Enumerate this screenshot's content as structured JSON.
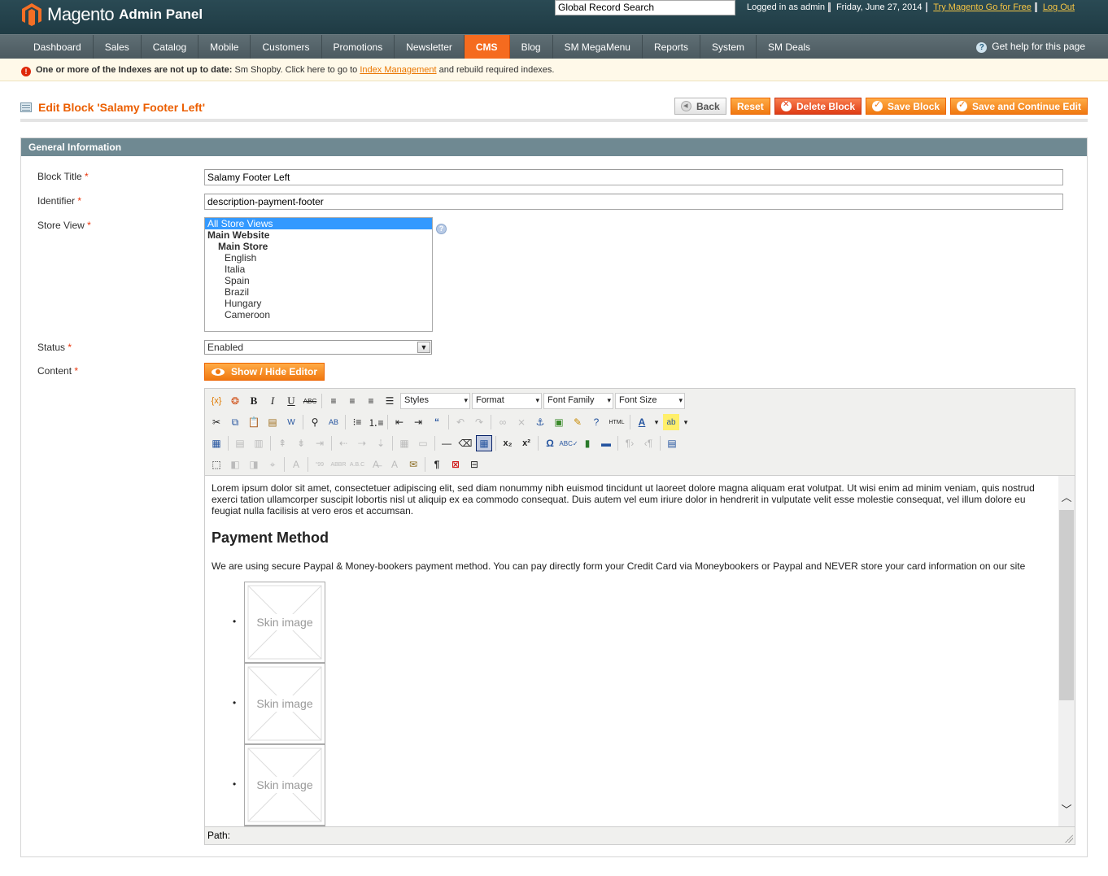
{
  "header": {
    "brand": "Magento",
    "panel": "Admin Panel",
    "search_placeholder": "Global Record Search",
    "logged_in": "Logged in as admin",
    "date": "Friday, June 27, 2014",
    "try_link": "Try Magento Go for Free",
    "logout_link": "Log Out"
  },
  "nav": {
    "items": [
      "Dashboard",
      "Sales",
      "Catalog",
      "Mobile",
      "Customers",
      "Promotions",
      "Newsletter",
      "CMS",
      "Blog",
      "SM MegaMenu",
      "Reports",
      "System",
      "SM Deals"
    ],
    "active": "CMS",
    "help": "Get help for this page"
  },
  "notice": {
    "bold": "One or more of the Indexes are not up to date:",
    "text": "Sm Shopby. Click here to go to",
    "link": "Index Management",
    "tail": "and rebuild required indexes."
  },
  "page": {
    "title": "Edit Block 'Salamy Footer Left'",
    "buttons": {
      "back": "Back",
      "reset": "Reset",
      "delete": "Delete Block",
      "save": "Save Block",
      "save_continue": "Save and Continue Edit"
    }
  },
  "form": {
    "section_title": "General Information",
    "block_title_label": "Block Title",
    "block_title_value": "Salamy Footer Left",
    "identifier_label": "Identifier",
    "identifier_value": "description-payment-footer",
    "store_view_label": "Store View",
    "store_views": {
      "all": "All Store Views",
      "website": "Main Website",
      "store": "Main Store",
      "views": [
        "English",
        "Italia",
        "Spain",
        "Brazil",
        "Hungary",
        "Cameroon"
      ]
    },
    "status_label": "Status",
    "status_value": "Enabled",
    "content_label": "Content",
    "show_hide": "Show / Hide Editor",
    "required": "*"
  },
  "editor": {
    "selects": [
      "Styles",
      "Format",
      "Font Family",
      "Font Size"
    ],
    "html_label": "HTML",
    "paragraph1": "Lorem ipsum dolor sit amet, consectetuer adipiscing elit, sed diam nonummy nibh euismod tincidunt ut laoreet dolore magna aliquam erat volutpat. Ut wisi enim ad minim veniam, quis nostrud exerci tation ullamcorper suscipit lobortis nisl ut aliquip ex ea commodo consequat. Duis autem vel eum iriure dolor in hendrerit in vulputate velit esse molestie consequat, vel illum dolore eu feugiat nulla facilisis at vero eros et accumsan.",
    "heading": "Payment Method",
    "paragraph2": "We are using secure Paypal & Money-bookers payment method. You can pay directly form your Credit Card via Moneybookers or Paypal and NEVER store your card information on our site",
    "images": [
      "Skin image",
      "Skin image",
      "Skin image"
    ],
    "path_label": "Path:"
  }
}
